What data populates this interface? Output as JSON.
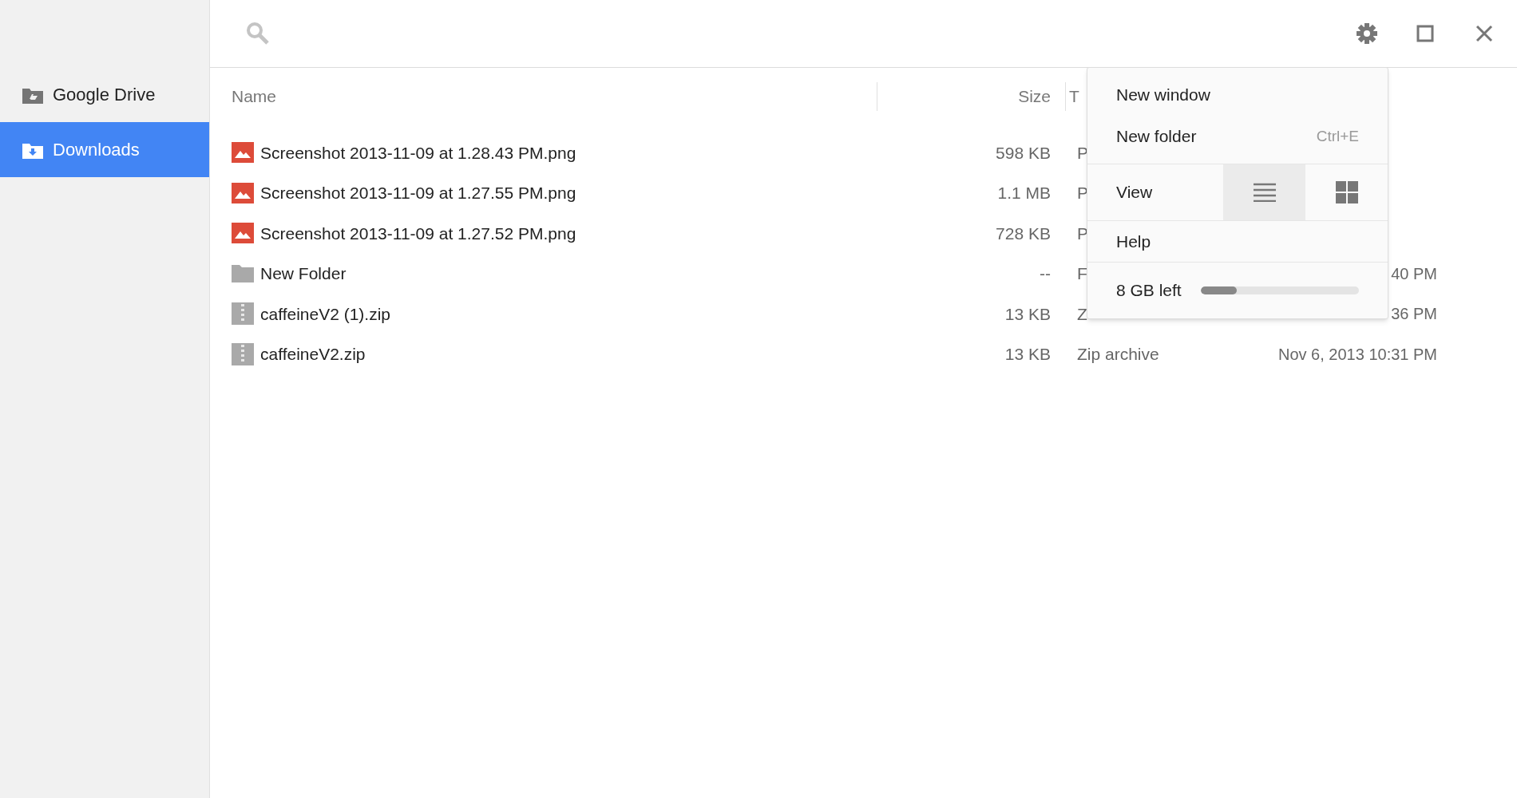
{
  "sidebar": {
    "items": [
      {
        "label": "Google Drive",
        "kind": "drive",
        "selected": false
      },
      {
        "label": "Downloads",
        "kind": "downloads",
        "selected": true
      }
    ]
  },
  "table": {
    "columns": [
      "Name",
      "Size",
      "T"
    ],
    "rows": [
      {
        "kind": "image",
        "name": "Screenshot 2013-11-09 at 1.28.43 PM.png",
        "size": "598 KB",
        "type": "P"
      },
      {
        "kind": "image",
        "name": "Screenshot 2013-11-09 at 1.27.55 PM.png",
        "size": "1.1 MB",
        "type": "P"
      },
      {
        "kind": "image",
        "name": "Screenshot 2013-11-09 at 1.27.52 PM.png",
        "size": "728 KB",
        "type": "P"
      },
      {
        "kind": "folder",
        "name": "New Folder",
        "size": "--",
        "type": "F",
        "date": "40 PM"
      },
      {
        "kind": "zip",
        "name": "caffeineV2 (1).zip",
        "size": "13 KB",
        "type": "Z",
        "date": "36 PM"
      },
      {
        "kind": "zip",
        "name": "caffeineV2.zip",
        "size": "13 KB",
        "type": "Zip archive",
        "date": "Nov 6, 2013 10:31 PM"
      }
    ]
  },
  "menu": {
    "items": [
      {
        "kind": "item",
        "label": "New window"
      },
      {
        "kind": "item",
        "label": "New folder",
        "shortcut": "Ctrl+E"
      },
      {
        "kind": "view",
        "label": "View",
        "options": [
          {
            "kind": "list",
            "selected": true
          },
          {
            "kind": "grid",
            "selected": false
          }
        ]
      },
      {
        "kind": "item",
        "label": "Help"
      },
      {
        "kind": "storage",
        "label": "8 GB left",
        "level": 0.23
      }
    ]
  }
}
